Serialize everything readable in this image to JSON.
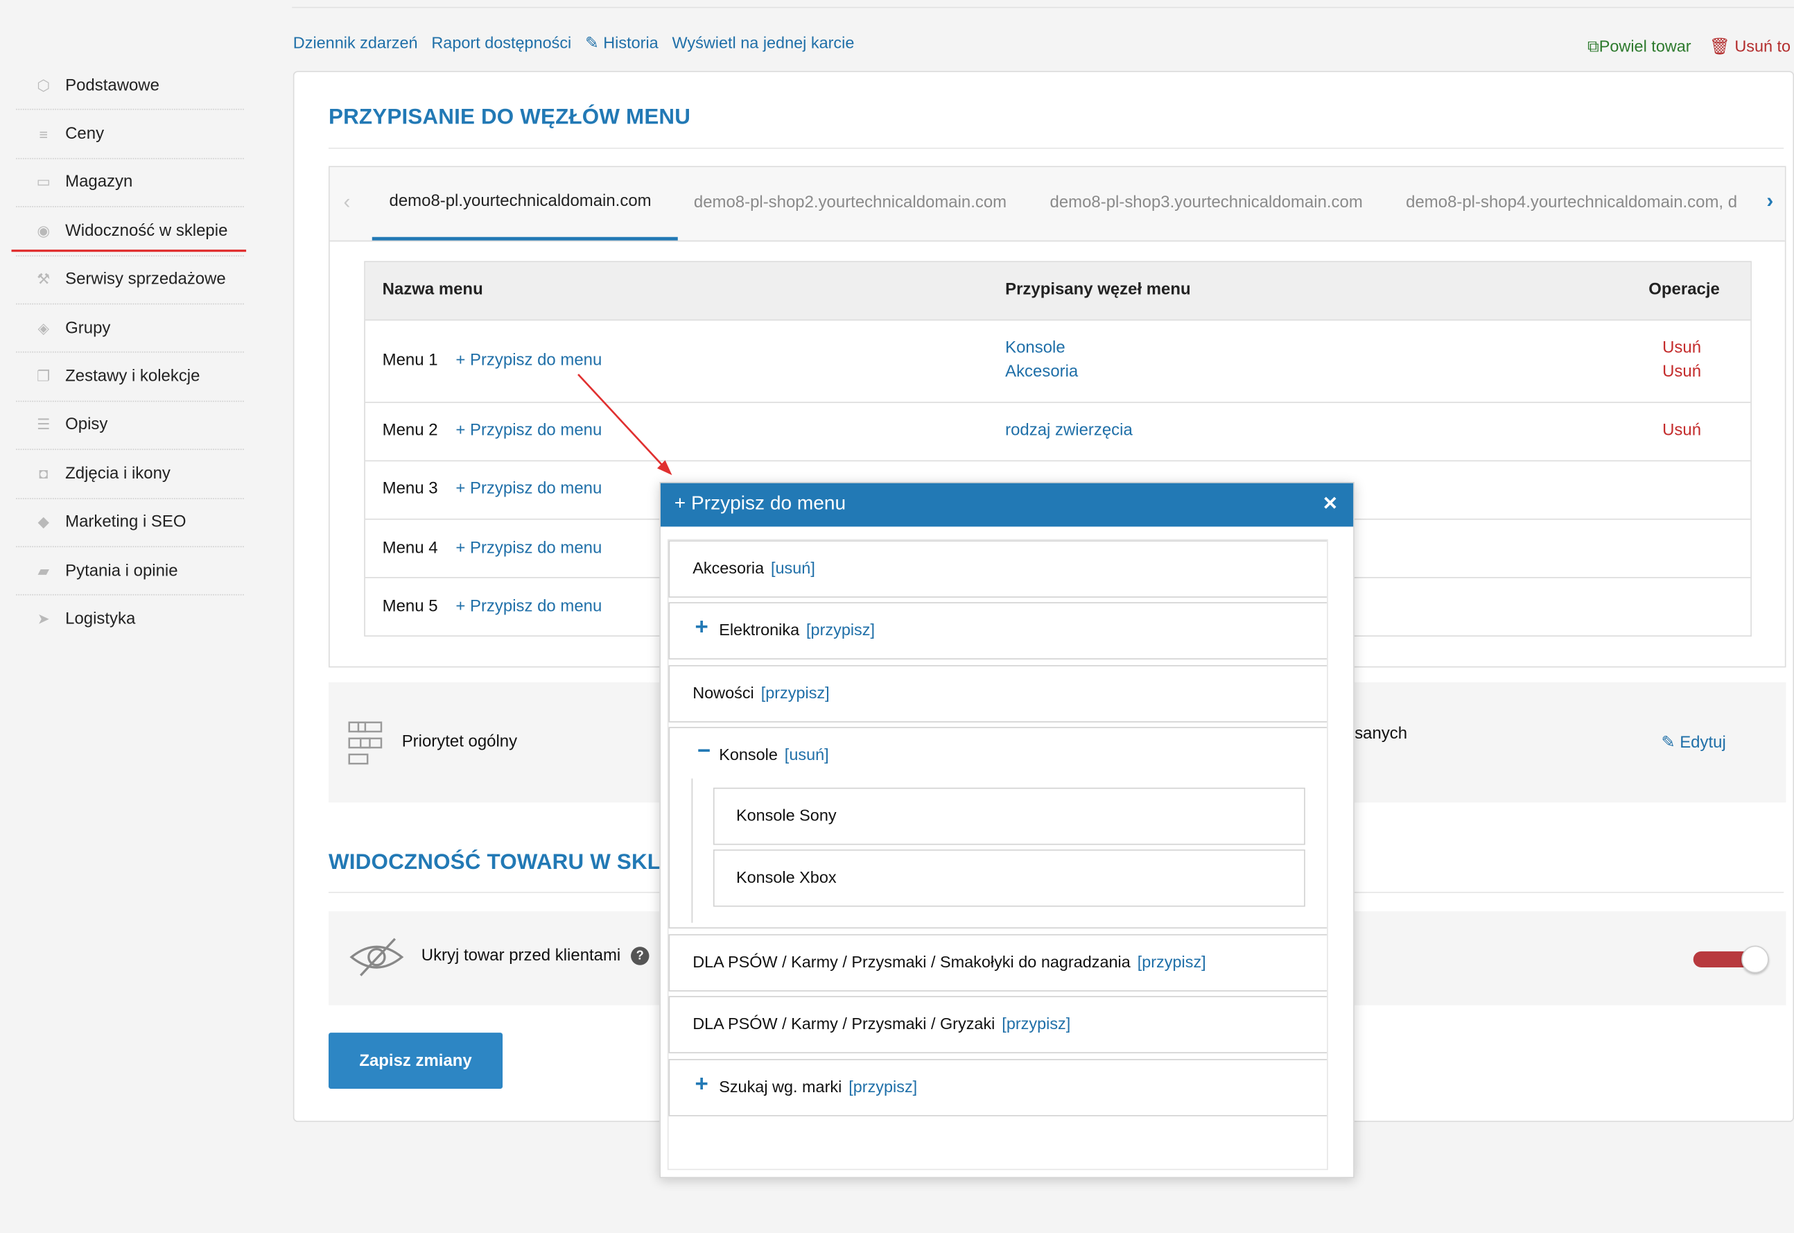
{
  "sidebar": {
    "items": [
      {
        "label": "Podstawowe",
        "icon": "box-icon"
      },
      {
        "label": "Ceny",
        "icon": "coins-icon"
      },
      {
        "label": "Magazyn",
        "icon": "archive-icon"
      },
      {
        "label": "Widoczność w sklepie",
        "icon": "eye-icon",
        "active": true
      },
      {
        "label": "Serwisy sprzedażowe",
        "icon": "hammer-icon"
      },
      {
        "label": "Grupy",
        "icon": "layers-icon"
      },
      {
        "label": "Zestawy i kolekcje",
        "icon": "stack-icon"
      },
      {
        "label": "Opisy",
        "icon": "lines-icon"
      },
      {
        "label": "Zdjęcia i ikony",
        "icon": "camera-icon"
      },
      {
        "label": "Marketing i SEO",
        "icon": "tag-icon"
      },
      {
        "label": "Pytania i opinie",
        "icon": "chat-icon"
      },
      {
        "label": "Logistyka",
        "icon": "send-icon"
      }
    ]
  },
  "toplinks": {
    "log": "Dziennik zdarzeń",
    "availability": "Raport dostępności",
    "history": "Historia",
    "single_card": "Wyświetl na jednej karcie"
  },
  "topright": {
    "duplicate": "Powiel towar",
    "delete": "Usuń to"
  },
  "section1": {
    "title": "PRZYPISANIE DO WĘZŁÓW MENU",
    "tabs": [
      "demo8-pl.yourtechnicaldomain.com",
      "demo8-pl-shop2.yourtechnicaldomain.com",
      "demo8-pl-shop3.yourtechnicaldomain.com",
      "demo8-pl-shop4.yourtechnicaldomain.com, d"
    ],
    "table": {
      "headers": {
        "name": "Nazwa menu",
        "node": "Przypisany węzeł menu",
        "ops": "Operacje"
      },
      "assign_label": "+ Przypisz do menu",
      "rows": [
        {
          "name": "Menu 1",
          "node1": "Konsole",
          "node2": "Akcesoria",
          "op1": "Usuń",
          "op2": "Usuń"
        },
        {
          "name": "Menu 2",
          "node1": "rodzaj zwierzęcia",
          "node2": "",
          "op1": "Usuń",
          "op2": ""
        },
        {
          "name": "Menu 3",
          "node1": "",
          "node2": "",
          "op1": "",
          "op2": ""
        },
        {
          "name": "Menu 4",
          "node1": "",
          "node2": "",
          "op1": "",
          "op2": ""
        },
        {
          "name": "Menu 5",
          "node1": "",
          "node2": "",
          "op1": "",
          "op2": ""
        }
      ]
    }
  },
  "priority": {
    "label": "Priorytet ogólny",
    "partial": "isanych",
    "edit": "Edytuj"
  },
  "section2": {
    "title": "WIDOCZNOŚĆ TOWARU W SKLEP",
    "hide_label": "Ukryj towar przed klientami",
    "help": "?"
  },
  "save_button": "Zapisz zmiany",
  "modal": {
    "title": "+ Przypisz do menu",
    "close": "×",
    "items": {
      "akcesoria": {
        "label": "Akcesoria",
        "action": "[usuń]"
      },
      "elektronika": {
        "label": "Elektronika",
        "action": "[przypisz]"
      },
      "nowosci": {
        "label": "Nowości",
        "action": "[przypisz]"
      },
      "konsole": {
        "label": "Konsole",
        "action": "[usuń]"
      },
      "konsole_sony": {
        "label": "Konsole Sony"
      },
      "konsole_xbox": {
        "label": "Konsole Xbox"
      },
      "dla_psow_1": {
        "label": "DLA PSÓW / Karmy / Przysmaki / Smakołyki do nagradzania",
        "action": "[przypisz]"
      },
      "dla_psow_2": {
        "label": "DLA PSÓW / Karmy / Przysmaki / Gryzaki",
        "action": "[przypisz]"
      },
      "szukaj": {
        "label": "Szukaj wg. marki",
        "action": "[przypisz]"
      }
    }
  },
  "colors": {
    "accent": "#2279b5",
    "danger": "#c42c2c",
    "success": "#2d7a2d",
    "toggle": "#b8393e",
    "annotation": "#e03030"
  }
}
